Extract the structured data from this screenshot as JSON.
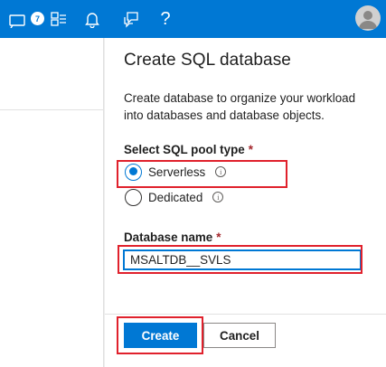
{
  "topbar": {
    "notification_count": "7",
    "icons": [
      "notifications-list-icon",
      "directory-icon",
      "bell-icon",
      "feedback-icon",
      "help-icon"
    ],
    "help_glyph": "?"
  },
  "panel": {
    "title": "Create SQL database",
    "description": "Create database to organize your workload into databases and database objects.",
    "pool_type": {
      "label": "Select SQL pool type",
      "required_mark": "*",
      "options": [
        {
          "label": "Serverless",
          "selected": true
        },
        {
          "label": "Dedicated",
          "selected": false
        }
      ]
    },
    "database_name": {
      "label": "Database name",
      "required_mark": "*",
      "value": "MSALTDB__SVLS"
    },
    "buttons": {
      "create": "Create",
      "cancel": "Cancel"
    }
  },
  "colors": {
    "accent": "#0078d4",
    "highlight": "#e0212c",
    "required": "#a4262c"
  }
}
